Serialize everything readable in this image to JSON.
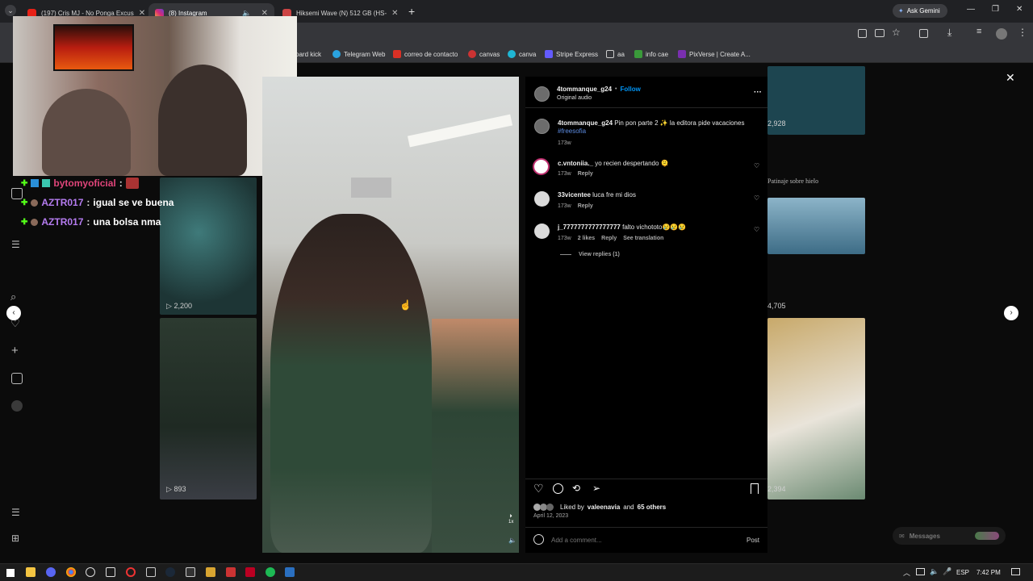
{
  "browser": {
    "tabs": [
      {
        "title": "(197) Cris MJ - No Ponga Excus",
        "active": false
      },
      {
        "title": "(8) Instagram",
        "active": true
      },
      {
        "title": "Hiksemi Wave (N) 512 GB (HS-",
        "active": false
      }
    ],
    "new_tab": "+",
    "ask_gemini": "Ask Gemini",
    "bookmarks": [
      "oard kick",
      "Telegram Web",
      "correo de contacto",
      "canvas",
      "canva",
      "Stripe Express",
      "aa",
      "info cae",
      "PixVerse | Create A..."
    ]
  },
  "stream_overlay": {
    "chat": [
      {
        "user": "bytomyoficial",
        "sep": ":",
        "msg": "",
        "user_color": "#e0457a"
      },
      {
        "user": "AZTR017",
        "sep": ":",
        "msg": "igual se ve buena",
        "user_color": "#b57cf0"
      },
      {
        "user": "AZTR017",
        "sep": ":",
        "msg": "una bolsa nma",
        "user_color": "#b57cf0"
      }
    ]
  },
  "background_grid": {
    "view_counts": [
      "2,928",
      "2,200",
      "4,705",
      "893",
      "2,394"
    ],
    "caption_right": "Patinaje sobre hielo"
  },
  "post": {
    "author": "4tommanque_g24",
    "follow": "Follow",
    "audio": "Original audio",
    "more": "···",
    "caption_user": "4tommanque_g24",
    "caption_text": "Pin pon parte 2 ✨ la editora pide vacaciones",
    "hashtag": "#freesofia",
    "caption_time": "173w",
    "comments": [
      {
        "user": "c.vntoniia._",
        "text": "yo recien despertando 🫠",
        "time": "173w",
        "likes": "",
        "reply": "Reply",
        "translation": ""
      },
      {
        "user": "33vicentee",
        "text": "luca fre mi dios",
        "time": "173w",
        "likes": "",
        "reply": "Reply",
        "translation": ""
      },
      {
        "user": "j_7777777777777777",
        "text": "falto vichototo😢😢😢",
        "time": "173w",
        "likes": "2 likes",
        "reply": "Reply",
        "translation": "See translation"
      }
    ],
    "view_replies": "View replies (1)",
    "liked_prefix": "Liked by",
    "liked_user": "valeenavia",
    "liked_and": "and",
    "liked_others": "65 others",
    "date": "April 12, 2023",
    "comment_placeholder": "Add a comment...",
    "post_button": "Post",
    "speed": "1x"
  },
  "messages": {
    "label": "Messages"
  },
  "taskbar": {
    "lang": "ESP",
    "time": "7:42 PM"
  },
  "colors": {
    "instagram_blue": "#0095f6",
    "hashtag": "#5c8be0"
  }
}
